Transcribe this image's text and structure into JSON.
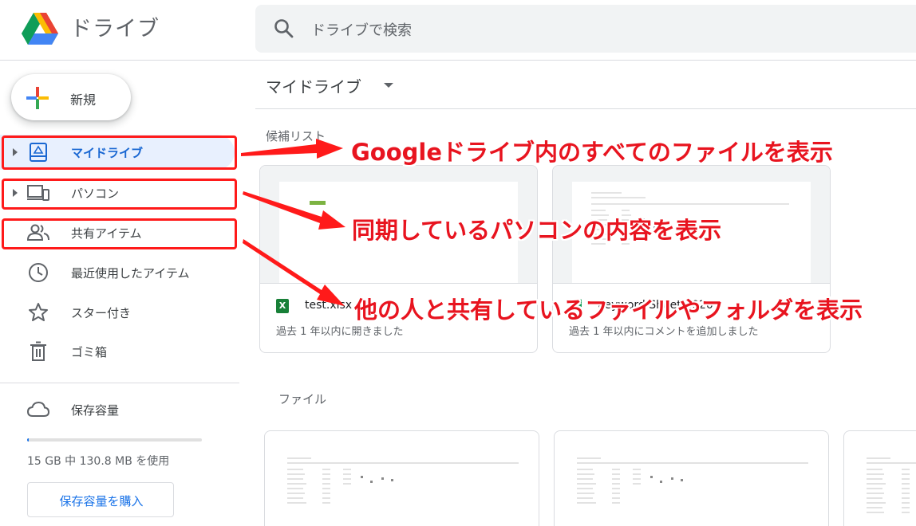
{
  "header": {
    "app_name": "ドライブ",
    "search_placeholder": "ドライブで検索"
  },
  "sidebar": {
    "new_label": "新規",
    "items": [
      {
        "label": "マイドライブ",
        "icon": "drive-icon",
        "active": true
      },
      {
        "label": "パソコン",
        "icon": "computers-icon"
      },
      {
        "label": "共有アイテム",
        "icon": "shared-people-icon"
      },
      {
        "label": "最近使用したアイテム",
        "icon": "clock-icon"
      },
      {
        "label": "スター付き",
        "icon": "star-icon"
      },
      {
        "label": "ゴミ箱",
        "icon": "trash-icon"
      },
      {
        "label": "保存容量",
        "icon": "cloud-icon"
      }
    ],
    "storage": {
      "text": "15 GB 中 130.8 MB を使用",
      "used_fraction": 0.0085
    },
    "buy_label": "保存容量を購入"
  },
  "main": {
    "title": "マイドライブ",
    "suggested_label": "候補リスト",
    "files_label": "ファイル",
    "suggested": [
      {
        "name": "test.xlsx",
        "sub": "過去 1 年以内に開きました",
        "file_icon": "excel-icon",
        "icon_text": "X"
      },
      {
        "name": "Keyword Sheet 2020",
        "sub": "過去 1 年以内にコメントを追加しました",
        "file_icon": "sheets-icon",
        "icon_text": ""
      }
    ]
  },
  "annotations": [
    {
      "text": "Googleドライブ内のすべてのファイルを表示"
    },
    {
      "text": "同期しているパソコンの内容を表示"
    },
    {
      "text": "他の人と共有しているファイルやフォルダを表示"
    }
  ],
  "colors": {
    "accent": "#1a73e8",
    "annotation_red": "#ff1a1a",
    "active_bg": "#e8f0fe"
  }
}
